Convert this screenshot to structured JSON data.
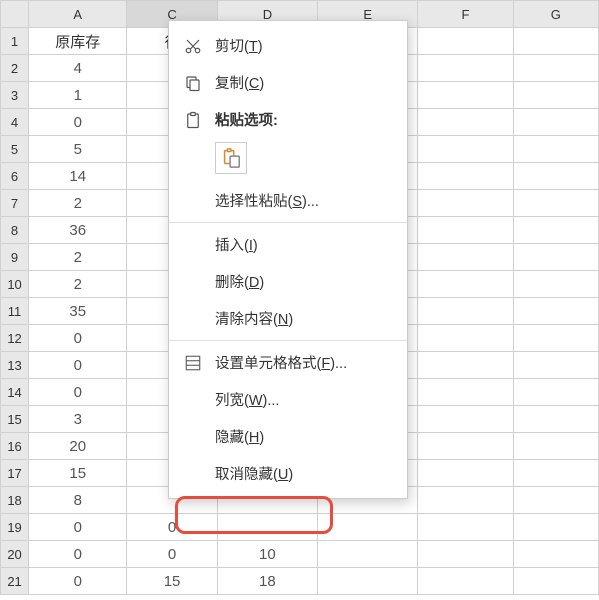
{
  "columns": [
    "A",
    "C",
    "D",
    "E",
    "F",
    "G"
  ],
  "row_numbers": [
    "1",
    "2",
    "3",
    "4",
    "5",
    "6",
    "7",
    "8",
    "9",
    "10",
    "11",
    "12",
    "13",
    "14",
    "15",
    "16",
    "17",
    "18",
    "19",
    "20",
    "21"
  ],
  "header_row": {
    "A": "原库存",
    "C": "待"
  },
  "data": {
    "A": [
      "4",
      "1",
      "0",
      "5",
      "14",
      "2",
      "36",
      "2",
      "2",
      "35",
      "0",
      "0",
      "0",
      "3",
      "20",
      "15",
      "8",
      "0",
      "0",
      "0"
    ],
    "C": [
      "",
      "",
      "",
      "",
      "",
      "",
      "",
      "",
      "",
      "",
      "",
      "",
      "",
      "",
      "",
      "",
      "",
      "0",
      "0",
      "15"
    ],
    "D": [
      "",
      "",
      "",
      "",
      "",
      "",
      "",
      "",
      "",
      "",
      "",
      "",
      "",
      "",
      "",
      "",
      "",
      "",
      "10",
      "18"
    ]
  },
  "menu": {
    "cut": "剪切(T)",
    "copy": "复制(C)",
    "paste_options": "粘贴选项:",
    "paste_special": "选择性粘贴(S)...",
    "insert": "插入(I)",
    "delete": "删除(D)",
    "clear": "清除内容(N)",
    "format_cells": "设置单元格格式(F)...",
    "col_width": "列宽(W)...",
    "hide": "隐藏(H)",
    "unhide": "取消隐藏(U)"
  }
}
